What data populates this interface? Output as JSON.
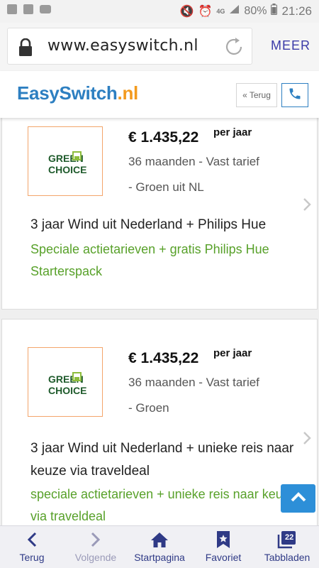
{
  "status_bar": {
    "network": "4G",
    "battery": "80%",
    "time": "21:26"
  },
  "browser": {
    "url": "www.easyswitch.nl",
    "menu_label": "MEER"
  },
  "site_header": {
    "logo_part1": "EasySwitch",
    "logo_part2": ".nl",
    "back_button": "« Terug",
    "phone_icon": "phone-icon"
  },
  "offers": [
    {
      "provider_line1": "GREEN",
      "provider_line2": "CHOICE",
      "price": "€ 1.435,22",
      "price_unit": "per jaar",
      "duration": "36 maanden - Vast tarief",
      "energy_type": "- Groen uit NL",
      "title": "3 jaar Wind uit Nederland + Philips Hue",
      "promo": "Speciale actietarieven + gratis Philips Hue Starterspack"
    },
    {
      "provider_line1": "GREEN",
      "provider_line2": "CHOICE",
      "price": "€ 1.435,22",
      "price_unit": "per jaar",
      "duration": "36 maanden - Vast tarief",
      "energy_type": "- Groen",
      "title": "3 jaar Wind uit Nederland + unieke reis naar keuze via traveldeal",
      "promo": "speciale actietarieven + unieke reis naar keuze via traveldeal"
    }
  ],
  "bottom_nav": [
    {
      "label": "Terug",
      "icon": "back-arrow-icon"
    },
    {
      "label": "Volgende",
      "icon": "forward-arrow-icon"
    },
    {
      "label": "Startpagina",
      "icon": "home-icon"
    },
    {
      "label": "Favoriet",
      "icon": "bookmark-star-icon"
    },
    {
      "label": "Tabbladen",
      "icon": "tabs-icon",
      "badge": "22"
    }
  ],
  "colors": {
    "brand_blue": "#2d7fc1",
    "brand_orange": "#f39a1e",
    "promo_green": "#58a12a",
    "nav_text": "#2f3a86"
  }
}
